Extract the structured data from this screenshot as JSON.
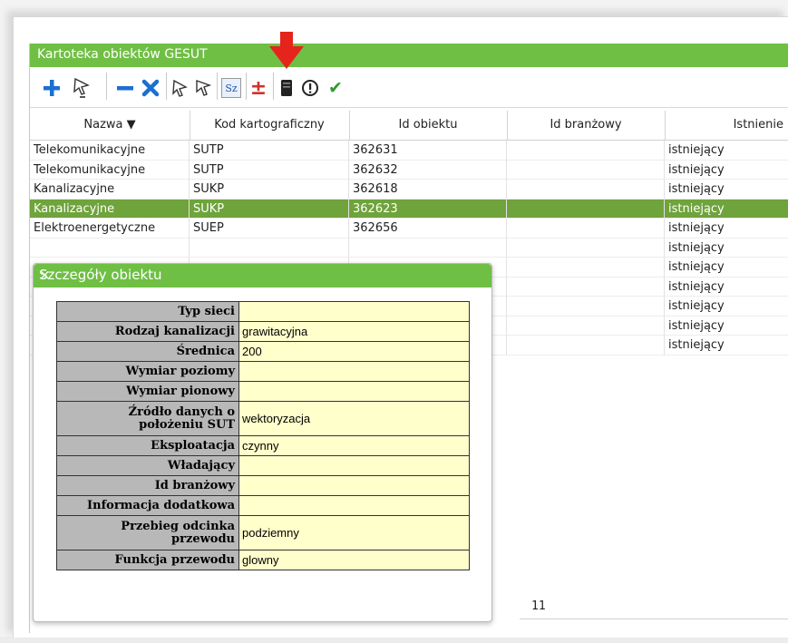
{
  "panel": {
    "title": "Kartoteka obiektów GESUT"
  },
  "toolbar": {
    "buttons": [
      {
        "name": "add-button",
        "icon": "plus-icon"
      },
      {
        "name": "select-object-button",
        "icon": "cursor-select-icon"
      },
      {
        "name": "remove-button",
        "icon": "minus-icon"
      },
      {
        "name": "delete-button",
        "icon": "cross-icon"
      },
      {
        "name": "edit-geometry-button",
        "icon": "edit-cursor-icon"
      },
      {
        "name": "show-geometry-button",
        "icon": "show-cursor-icon"
      },
      {
        "name": "details-button",
        "icon": "sz-icon",
        "label": "Sz"
      },
      {
        "name": "plus-minus-button",
        "icon": "plus-minus-icon",
        "label": "±"
      },
      {
        "name": "document-button",
        "icon": "dark-document-icon"
      },
      {
        "name": "warning-button",
        "icon": "exclamation-icon",
        "label": "!"
      },
      {
        "name": "accept-button",
        "icon": "check-icon",
        "label": "✔"
      }
    ],
    "highlight_arrow_color": "#e5241c"
  },
  "grid": {
    "columns": [
      "Nazwa ▼",
      "Kod kartograficzny",
      "Id obiektu",
      "Id branżowy",
      "Istnienie"
    ],
    "rows": [
      {
        "nazwa": "Telekomunikacyjne",
        "kod": "SUTP",
        "id": "362631",
        "idb": "",
        "ist": "istniejący",
        "selected": false
      },
      {
        "nazwa": "Telekomunikacyjne",
        "kod": "SUTP",
        "id": "362632",
        "idb": "",
        "ist": "istniejący",
        "selected": false
      },
      {
        "nazwa": "Kanalizacyjne",
        "kod": "SUKP",
        "id": "362618",
        "idb": "",
        "ist": "istniejący",
        "selected": false
      },
      {
        "nazwa": "Kanalizacyjne",
        "kod": "SUKP",
        "id": "362623",
        "idb": "",
        "ist": "istniejący",
        "selected": true
      },
      {
        "nazwa": "Elektroenergetyczne",
        "kod": "SUEP",
        "id": "362656",
        "idb": "",
        "ist": "istniejący",
        "selected": false
      },
      {
        "nazwa": "",
        "kod": "",
        "id": "",
        "idb": "",
        "ist": "istniejący",
        "selected": false
      },
      {
        "nazwa": "",
        "kod": "",
        "id": "",
        "idb": "",
        "ist": "istniejący",
        "selected": false
      },
      {
        "nazwa": "",
        "kod": "",
        "id": "",
        "idb": "",
        "ist": "istniejący",
        "selected": false
      },
      {
        "nazwa": "",
        "kod": "",
        "id": "",
        "idb": "",
        "ist": "istniejący",
        "selected": false
      },
      {
        "nazwa": "",
        "kod": "",
        "id": "",
        "idb": "",
        "ist": "istniejący",
        "selected": false
      },
      {
        "nazwa": "",
        "kod": "",
        "id": "",
        "idb": "",
        "ist": "istniejący",
        "selected": false
      }
    ],
    "footer_count": "11",
    "selection_color": "#6fa33b",
    "header_color": "#6fbf44"
  },
  "dialog": {
    "title": "Szczegóły obiektu",
    "close": "×",
    "fields": [
      {
        "label": "Typ sieci",
        "value": ""
      },
      {
        "label": "Rodzaj kanalizacji",
        "value": "grawitacyjna"
      },
      {
        "label": "Średnica",
        "value": "200"
      },
      {
        "label": "Wymiar poziomy",
        "value": ""
      },
      {
        "label": "Wymiar pionowy",
        "value": ""
      },
      {
        "label": "Źródło danych o położeniu SUT",
        "value": "wektoryzacja"
      },
      {
        "label": "Eksploatacja",
        "value": "czynny"
      },
      {
        "label": "Władający",
        "value": ""
      },
      {
        "label": "Id branżowy",
        "value": ""
      },
      {
        "label": "Informacja dodatkowa",
        "value": ""
      },
      {
        "label": "Przebieg odcinka przewodu",
        "value": "podziemny"
      },
      {
        "label": "Funkcja przewodu",
        "value": "glowny"
      }
    ]
  }
}
